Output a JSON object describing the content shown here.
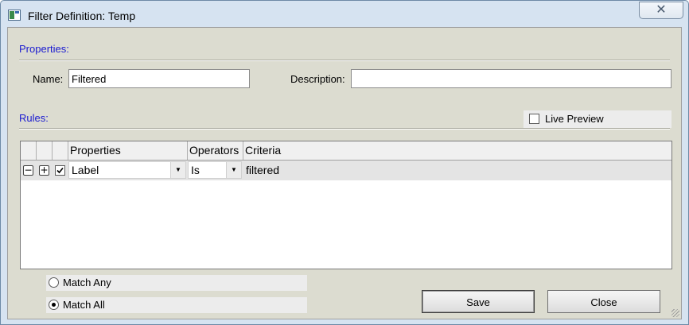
{
  "window": {
    "title": "Filter Definition: Temp",
    "close_glyph": "✕"
  },
  "properties": {
    "section_label": "Properties:",
    "name_label": "Name:",
    "name_value": "Filtered",
    "description_label": "Description:",
    "description_value": ""
  },
  "rules": {
    "section_label": "Rules:",
    "live_preview_label": "Live Preview",
    "live_preview_checked": false,
    "columns": [
      "Properties",
      "Operators",
      "Criteria"
    ],
    "rows": [
      {
        "remove_glyph": "−",
        "add_glyph": "+",
        "enabled": true,
        "property": "Label",
        "operator": "Is",
        "criteria": "filtered"
      }
    ]
  },
  "match": {
    "any_label": "Match Any",
    "all_label": "Match All",
    "selected": "all"
  },
  "buttons": {
    "save_label": "Save",
    "close_label": "Close"
  },
  "icons": {
    "window": "app-window-icon",
    "dropdown": "chevron-down-icon",
    "check": "checkmark-icon"
  }
}
